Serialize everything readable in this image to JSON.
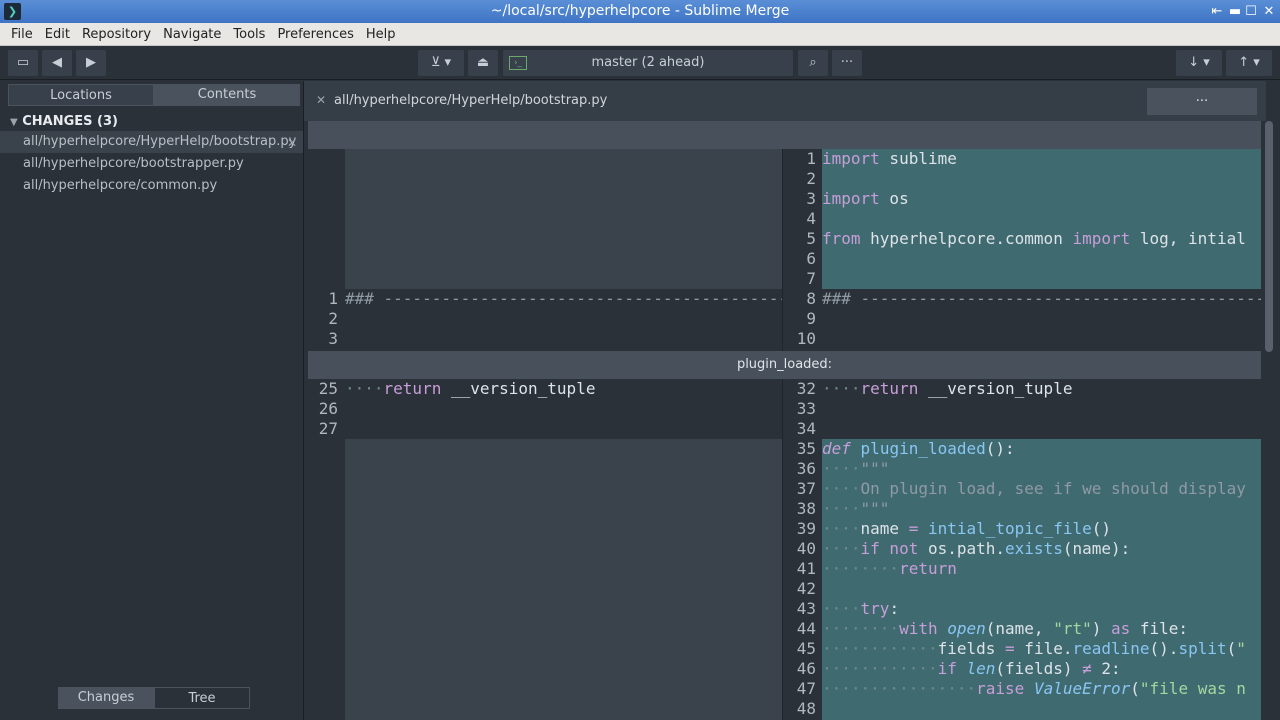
{
  "window": {
    "title": "~/local/src/hyperhelpcore - Sublime Merge"
  },
  "menu": [
    "File",
    "Edit",
    "Repository",
    "Navigate",
    "Tools",
    "Preferences",
    "Help"
  ],
  "toolbar": {
    "branch": "master (2 ahead)"
  },
  "sidebar": {
    "tabs": [
      "Locations",
      "Contents"
    ],
    "section_title": "CHANGES (3)",
    "files": [
      "all/hyperhelpcore/HyperHelp/bootstrap.py",
      "all/hyperhelpcore/bootstrapper.py",
      "all/hyperhelpcore/common.py"
    ],
    "bottom_tabs": [
      "Changes",
      "Tree"
    ]
  },
  "file_header": {
    "path": "all/hyperhelpcore/HyperHelp/bootstrap.py"
  },
  "hunk": {
    "label": "plugin_loaded:"
  },
  "left": {
    "numbers_a": [
      "1",
      "2",
      "3"
    ],
    "numbers_b": [
      "25",
      "26",
      "27"
    ]
  },
  "right": {
    "numbers_a": [
      "1",
      "2",
      "3",
      "4",
      "5",
      "6",
      "7",
      "8",
      "9",
      "10"
    ],
    "numbers_b": [
      "32",
      "33",
      "34",
      "35",
      "36",
      "37",
      "38",
      "39",
      "40",
      "41",
      "42",
      "43",
      "44",
      "45",
      "46",
      "47",
      "48"
    ]
  },
  "code": {
    "import_sublime": "import sublime",
    "import_os": "import os",
    "from_line": "from hyperhelpcore.common import log, intial",
    "hash_line": "### -----------------------------------------------------------------------",
    "return_line": "    return __version_tuple",
    "def_line": "def plugin_loaded():",
    "doc_open": "    \"\"\"",
    "doc_text": "    On plugin load, see if we should display",
    "doc_close": "    \"\"\"",
    "name_line": "    name = intial_topic_file()",
    "if_line": "    if not os.path.exists(name):",
    "return2": "        return",
    "try_line": "    try:",
    "with_line": "        with open(name, \"rt\") as file:",
    "fields_line": "            fields = file.readline().split(\"",
    "iflen_line": "            if len(fields) ≠ 2:",
    "raise_line": "                raise ValueError(\"file was n"
  },
  "colors": {
    "added": "#3f6a70",
    "context": "#2b3138",
    "hunk": "#48515b",
    "accent": "#4fd0c0"
  },
  "icons": [
    "sidebar-toggle-icon",
    "back-arrow-icon",
    "forward-arrow-icon",
    "stash-icon",
    "pop-icon",
    "terminal-icon",
    "search-icon",
    "more-icon",
    "pull-icon",
    "push-icon",
    "close-icon"
  ]
}
